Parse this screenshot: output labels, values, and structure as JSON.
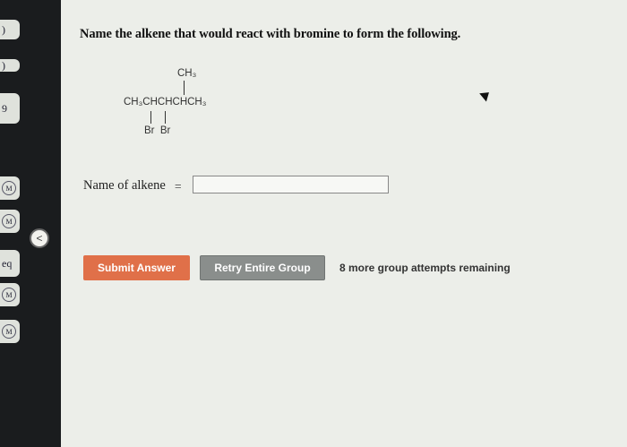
{
  "question": {
    "text": "Name the alkene that would react with bromine to form the following."
  },
  "formula": {
    "top_group": "CH₃",
    "main_chain": "CH₃CHCHCHCH₃",
    "substituents": "Br  Br"
  },
  "answer": {
    "label": "Name of alkene",
    "equals": "=",
    "value": "",
    "placeholder": ""
  },
  "buttons": {
    "submit_label": "Submit Answer",
    "retry_label": "Retry Entire Group"
  },
  "status": {
    "attempts_text": "8 more group attempts remaining"
  },
  "sidebar": {
    "items": [
      {
        "label": ")"
      },
      {
        "label": "9"
      },
      {
        "label": "M"
      },
      {
        "label": "M"
      },
      {
        "label": "eq"
      },
      {
        "label": "M"
      },
      {
        "label": "M"
      }
    ],
    "collapse_symbol": "<"
  },
  "colors": {
    "submit": "#e07049",
    "retry": "#8a8e8c",
    "sidebar": "#1a1c1e",
    "background": "#eceee9"
  }
}
